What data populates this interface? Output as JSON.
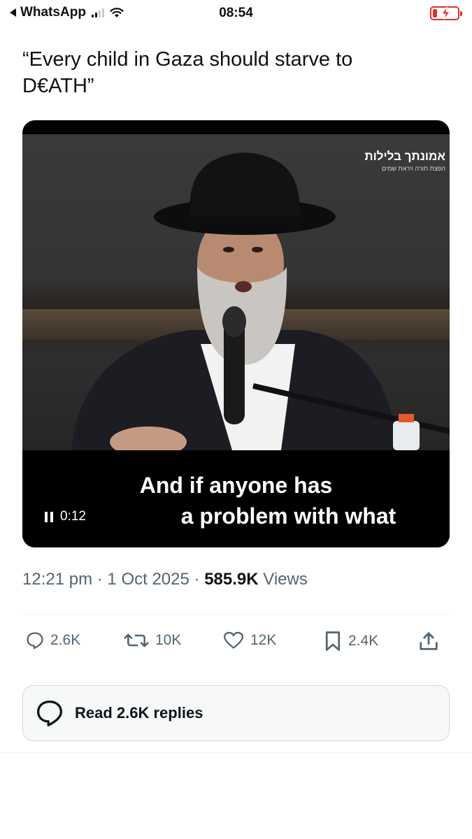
{
  "status_bar": {
    "back_app": "WhatsApp",
    "time": "08:54"
  },
  "tweet": {
    "text": "“Every child in Gaza should starve to D€ATH”",
    "video": {
      "channel_logo": "אמונתך בלילות",
      "channel_tagline": "הפצת תורה ויראת שמים",
      "subtitle_line1": "And if anyone has",
      "subtitle_line2": "a problem with what",
      "elapsed": "0:12"
    },
    "meta": {
      "time": "12:21 pm",
      "separator1": "·",
      "date": "1 Oct 2025",
      "separator2": "·",
      "views_count": "585.9K",
      "views_label": "Views"
    },
    "actions": {
      "replies": "2.6K",
      "reposts": "10K",
      "likes": "12K",
      "bookmarks": "2.4K"
    },
    "read_replies_label": "Read 2.6K replies"
  },
  "colors": {
    "battery_low": "#e0322c",
    "secondary_text": "#536471",
    "primary_text": "#0f1419"
  }
}
